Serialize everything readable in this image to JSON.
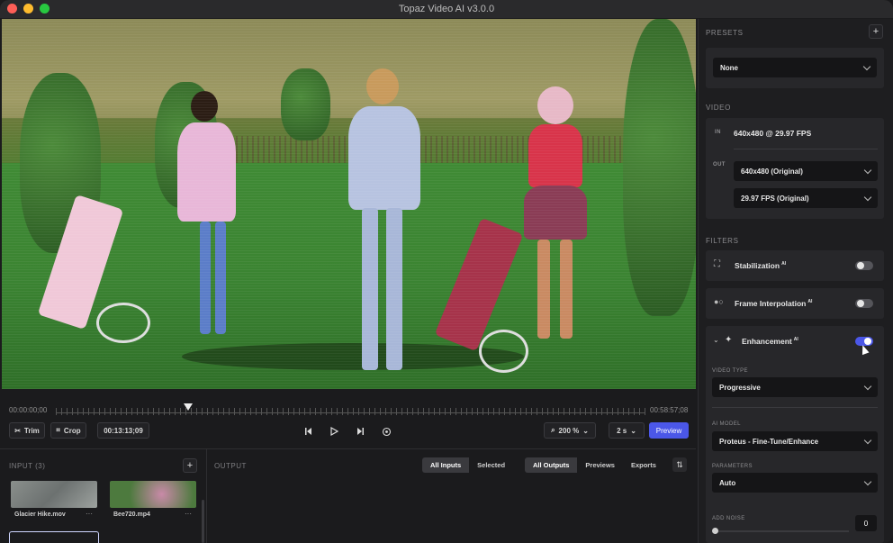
{
  "window": {
    "title": "Topaz Video AI  v3.0.0"
  },
  "timeline": {
    "start": "00:00:00;00",
    "end": "00:58:57;08"
  },
  "controls": {
    "trim_label": "Trim",
    "crop_label": "Crop",
    "timecode": "00:13:13;09",
    "zoom": "200 %",
    "speed": "2 s",
    "preview_label": "Preview"
  },
  "input": {
    "label": "INPUT (3)",
    "files": [
      {
        "name": "Glacier Hike.mov"
      },
      {
        "name": "Bee720.mp4"
      }
    ]
  },
  "output": {
    "label": "OUTPUT",
    "input_tabs": [
      "All Inputs",
      "Selected"
    ],
    "output_tabs": [
      "All Outputs",
      "Previews",
      "Exports"
    ]
  },
  "panel": {
    "presets_label": "PRESETS",
    "preset_value": "None",
    "video_label": "VIDEO",
    "in_tag": "IN",
    "in_value": "640x480 @ 29.97 FPS",
    "out_tag": "OUT",
    "out_resolution": "640x480 (Original)",
    "out_fps": "29.97 FPS (Original)",
    "filters_label": "FILTERS",
    "filters": [
      {
        "label": "Stabilization",
        "ai": "AI",
        "enabled": false
      },
      {
        "label": "Frame Interpolation",
        "ai": "AI",
        "enabled": false
      },
      {
        "label": "Enhancement",
        "ai": "AI",
        "enabled": true
      }
    ],
    "video_type_label": "VIDEO TYPE",
    "video_type": "Progressive",
    "ai_model_label": "AI MODEL",
    "ai_model": "Proteus - Fine-Tune/Enhance",
    "parameters_label": "PARAMETERS",
    "parameters": "Auto",
    "add_noise_label": "ADD NOISE",
    "add_noise_value": "0"
  },
  "colors": {
    "accent": "#4b57e8",
    "background": "#1b1b1d",
    "panel": "#27272a"
  }
}
